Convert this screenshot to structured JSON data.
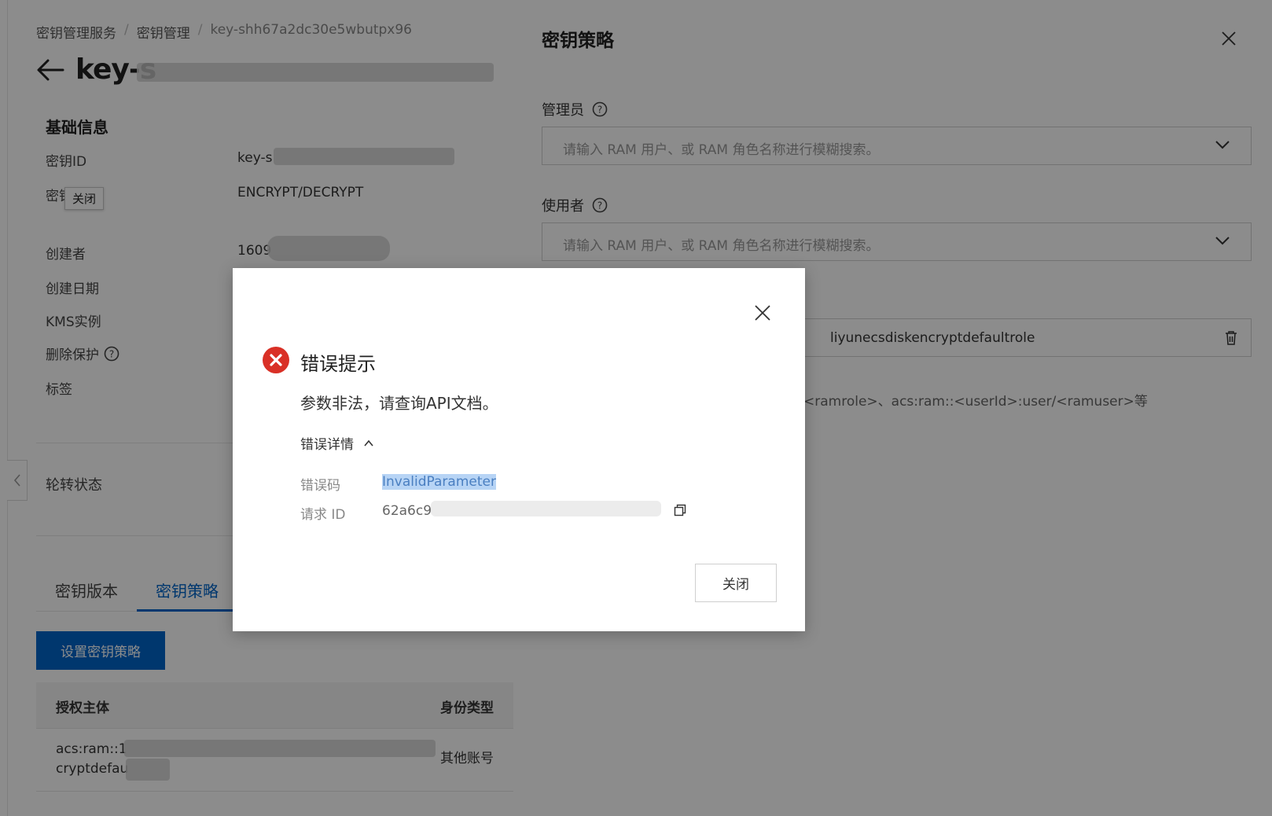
{
  "breadcrumb": [
    "密钥管理服务",
    "密钥管理",
    "key-shh67a2dc30e5wbutpx96"
  ],
  "page_title_prefix": "key-s",
  "basic_info": {
    "section_title": "基础信息",
    "key_id_label": "密钥ID",
    "key_id_value_prefix": "key-s",
    "usage_label_partial": "密钥",
    "usage_value": "ENCRYPT/DECRYPT",
    "creator_label": "创建者",
    "creator_value_prefix": "1609",
    "created_date_label": "创建日期",
    "kms_instance_label": "KMS实例",
    "delete_protection_label": "删除保护",
    "tags_label": "标签"
  },
  "tooltip": "关闭",
  "rotation_label": "轮转状态",
  "tabs": [
    {
      "label": "密钥版本",
      "active": false
    },
    {
      "label": "密钥策略",
      "active": true
    }
  ],
  "set_policy_button": "设置密钥策略",
  "policy_table": {
    "columns": [
      "授权主体",
      "身份类型"
    ],
    "rows": [
      {
        "principal_line1": "acs:ram::1",
        "principal_line2": "cryptdefau",
        "identity_type": "其他账号"
      }
    ]
  },
  "drawer": {
    "title": "密钥策略",
    "admin_label": "管理员",
    "admin_placeholder": "请输入 RAM 用户、或 RAM 角色名称进行模糊搜索。",
    "user_label": "使用者",
    "user_placeholder": "请输入 RAM 用户、或 RAM 角色名称进行模糊搜索。",
    "role_value_partial": "liyunecsdiskencryptdefaultrole",
    "hint_partial": "<ramrole>、acs:ram::<userId>:user/<ramuser>等"
  },
  "modal": {
    "title": "错误提示",
    "message": "参数非法，请查询API文档。",
    "details_toggle": "错误详情",
    "error_code_label": "错误码",
    "error_code_value": "InvalidParameter",
    "request_id_label": "请求 ID",
    "request_id_prefix": "62a6c9",
    "close_button": "关闭"
  },
  "colors": {
    "primary": "#0064c8",
    "error": "#d93026",
    "selection": "#b7d4f5"
  },
  "icons": [
    "back-arrow-icon",
    "help-icon",
    "chevron-down-icon",
    "close-icon",
    "trash-icon",
    "error-icon",
    "chevron-up-icon",
    "copy-icon",
    "chevron-left-icon"
  ]
}
